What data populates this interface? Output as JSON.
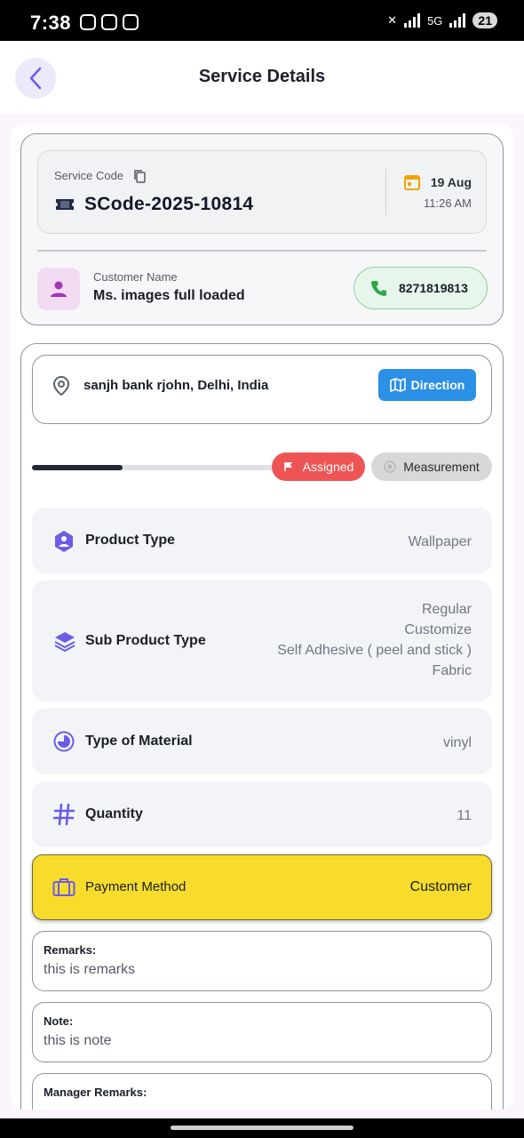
{
  "status_bar": {
    "time": "7:38",
    "network": "5G",
    "battery": "21"
  },
  "header": {
    "title": "Service Details"
  },
  "service": {
    "code_label": "Service Code",
    "code": "SCode-2025-10814",
    "date": "19 Aug",
    "time": "11:26 AM"
  },
  "customer": {
    "label": "Customer Name",
    "name": "Ms. images full loaded",
    "phone": "8271819813"
  },
  "address": {
    "text": "sanjh bank rjohn, Delhi, India",
    "direction_label": "Direction"
  },
  "progress": {
    "fraction": 0.35,
    "assigned_label": "Assigned",
    "measurement_label": "Measurement"
  },
  "details": {
    "product_type": {
      "label": "Product Type",
      "value": "Wallpaper"
    },
    "sub_product_type": {
      "label": "Sub Product Type",
      "values": [
        "Regular",
        "Customize",
        "Self Adhesive ( peel and stick )",
        "Fabric"
      ]
    },
    "material": {
      "label": "Type of Material",
      "value": "vinyl"
    },
    "quantity": {
      "label": "Quantity",
      "value": "11"
    }
  },
  "payment": {
    "label": "Payment Method",
    "value": "Customer"
  },
  "remarks": {
    "title": "Remarks:",
    "text": "this is remarks"
  },
  "note": {
    "title": "Note:",
    "text": "this is note"
  },
  "manager_remarks": {
    "title": "Manager Remarks:"
  },
  "colors": {
    "accent": "#6c5ce7",
    "direction": "#2b90e6",
    "assigned": "#ef5454",
    "payment_bg": "#f7dc2c",
    "phone_green": "#2ea84a"
  },
  "icons": [
    "back-arrow-icon",
    "copy-icon",
    "ticket-icon",
    "calendar-icon",
    "person-icon",
    "phone-icon",
    "location-pin-icon",
    "map-icon",
    "flag-icon",
    "radio-dot-icon",
    "hexagon-icon",
    "layers-icon",
    "material-icon",
    "hash-icon",
    "wallet-icon"
  ]
}
